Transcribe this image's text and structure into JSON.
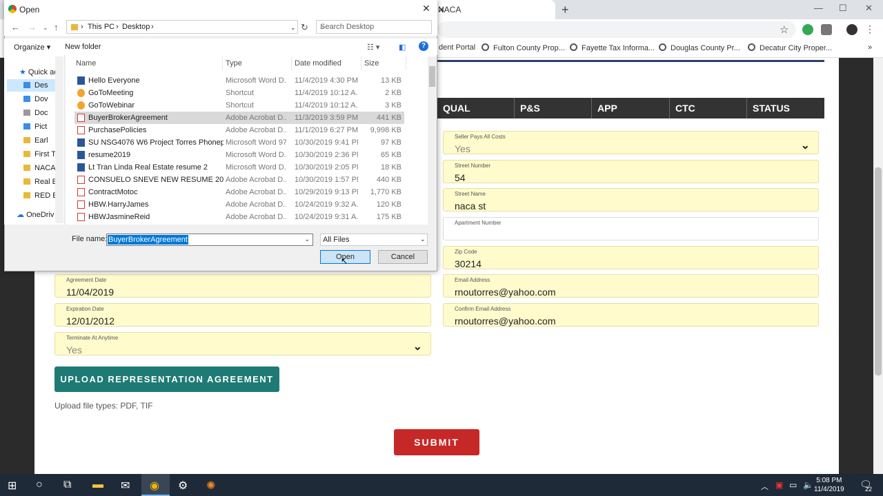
{
  "browser": {
    "tab_title": "NACA",
    "tab_close": "✕",
    "new_tab": "+",
    "bookmarks": [
      "dent Portal",
      "Fulton County Prop...",
      "Fayette Tax Informa...",
      "Douglas County Pr...",
      "Decatur City Proper..."
    ],
    "bookmarks_more": "»",
    "window_controls": {
      "minimize": "—",
      "maximize": "☐",
      "close": "✕"
    }
  },
  "form": {
    "steps": [
      "QUAL",
      "P&S",
      "APP",
      "CTC",
      "STATUS"
    ],
    "right_fields": [
      {
        "label": "Seller Pays All Costs",
        "value": "Yes",
        "muted": true,
        "dropdown": true
      },
      {
        "label": "Street Number",
        "value": "54"
      },
      {
        "label": "Street Name",
        "value": "naca st"
      },
      {
        "label": "Apartment Number",
        "value": "",
        "white": true
      },
      {
        "label": "Zip Code",
        "value": "30214"
      },
      {
        "label": "Email Address",
        "value": "rnoutorres@yahoo.com"
      },
      {
        "label": "Confirm Email Address",
        "value": "rnoutorres@yahoo.com"
      }
    ],
    "left_fields": [
      {
        "label": "Agreement Date",
        "value": "11/04/2019"
      },
      {
        "label": "Expiration Date",
        "value": "12/01/2012"
      },
      {
        "label": "Terminate At Anytime",
        "value": "Yes",
        "muted": true,
        "dropdown": true
      }
    ],
    "upload_button": "UPLOAD REPRESENTATION AGREEMENT",
    "upload_types": "Upload file types: PDF, TIF",
    "submit_button": "SUBMIT"
  },
  "dialog": {
    "title": "Open",
    "breadcrumb": [
      "This PC",
      "Desktop"
    ],
    "search_placeholder": "Search Desktop",
    "organize": "Organize ▾",
    "new_folder": "New folder",
    "help": "?",
    "nav_items": [
      "Quick ac",
      "Des",
      "Dov",
      "Doc",
      "Pict",
      "Earl",
      "First Tu",
      "NACA",
      "Real Es",
      "RED Er",
      "OneDriv"
    ],
    "columns": [
      "Name",
      "Type",
      "Date modified",
      "Size"
    ],
    "files": [
      {
        "name": "Hello Everyone",
        "type": "Microsoft Word D...",
        "date": "11/4/2019 4:30 PM",
        "size": "13 KB",
        "icon": "word"
      },
      {
        "name": "GoToMeeting",
        "type": "Shortcut",
        "date": "11/4/2019 10:12 A...",
        "size": "2 KB",
        "icon": "sc"
      },
      {
        "name": "GoToWebinar",
        "type": "Shortcut",
        "date": "11/4/2019 10:12 A...",
        "size": "3 KB",
        "icon": "sc"
      },
      {
        "name": "BuyerBrokerAgreement",
        "type": "Adobe Acrobat D...",
        "date": "11/3/2019 3:59 PM",
        "size": "441 KB",
        "icon": "pdf",
        "selected": true
      },
      {
        "name": "PurchasePolicies",
        "type": "Adobe Acrobat D...",
        "date": "11/1/2019 6:27 PM",
        "size": "9,998 KB",
        "icon": "pdf"
      },
      {
        "name": "SU NSG4076 W6 Project Torres Phonephe...",
        "type": "Microsoft Word 97...",
        "date": "10/30/2019 9:41 PM",
        "size": "97 KB",
        "icon": "word"
      },
      {
        "name": "resume2019",
        "type": "Microsoft Word D...",
        "date": "10/30/2019 2:36 PM",
        "size": "65 KB",
        "icon": "word"
      },
      {
        "name": "Lt Tran Linda Real Estate resume 2",
        "type": "Microsoft Word D...",
        "date": "10/30/2019 2:05 PM",
        "size": "18 KB",
        "icon": "word"
      },
      {
        "name": "CONSUELO SNEVE NEW RESUME 205082...",
        "type": "Adobe Acrobat D...",
        "date": "10/30/2019 1:57 PM",
        "size": "440 KB",
        "icon": "pdf"
      },
      {
        "name": "ContractMotoc",
        "type": "Adobe Acrobat D...",
        "date": "10/29/2019 9:13 PM",
        "size": "1,770 KB",
        "icon": "pdf"
      },
      {
        "name": "HBW.HarryJames",
        "type": "Adobe Acrobat D...",
        "date": "10/24/2019 9:32 A...",
        "size": "120 KB",
        "icon": "pdf"
      },
      {
        "name": "HBWJasmineReid",
        "type": "Adobe Acrobat D...",
        "date": "10/24/2019 9:31 A...",
        "size": "175 KB",
        "icon": "pdf"
      }
    ],
    "file_name_label": "File name:",
    "file_name_value": "BuyerBrokerAgreement",
    "filter": "All Files",
    "open_button": "Open",
    "cancel_button": "Cancel"
  },
  "taskbar": {
    "time": "5:08 PM",
    "date": "11/4/2019",
    "notifications": "22"
  }
}
